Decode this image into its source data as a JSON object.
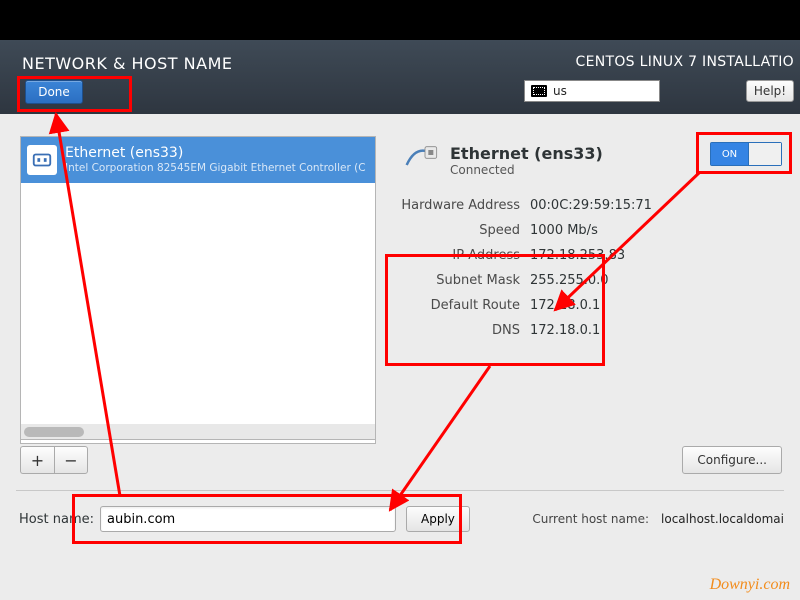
{
  "header": {
    "title": "NETWORK & HOST NAME",
    "subtitle": "CENTOS LINUX 7 INSTALLATIO",
    "done_label": "Done",
    "keyboard_layout": "us",
    "help_label": "Help!"
  },
  "device_list": {
    "selected": {
      "name": "Ethernet (ens33)",
      "desc": "Intel Corporation 82545EM Gigabit Ethernet Controller (C"
    },
    "add_label": "+",
    "remove_label": "−"
  },
  "detail": {
    "title": "Ethernet (ens33)",
    "status": "Connected",
    "toggle_on_label": "ON",
    "rows": {
      "hw_k": "Hardware Address",
      "hw_v": "00:0C:29:59:15:71",
      "sp_k": "Speed",
      "sp_v": "1000 Mb/s",
      "ip_k": "IP Address",
      "ip_v": "172.18.253.83",
      "sm_k": "Subnet Mask",
      "sm_v": "255.255.0.0",
      "gw_k": "Default Route",
      "gw_v": "172.18.0.1",
      "dn_k": "DNS",
      "dn_v": "172.18.0.1"
    },
    "configure_label": "Configure..."
  },
  "hostname": {
    "label": "Host name:",
    "value": "aubin.com",
    "apply_label": "Apply",
    "current_label": "Current host name:",
    "current_value": "localhost.localdomai"
  },
  "watermark": "Downyi.com"
}
